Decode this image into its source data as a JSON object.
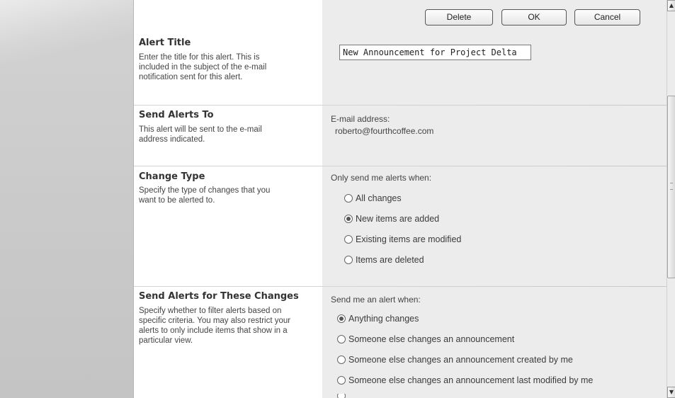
{
  "buttons": {
    "delete": "Delete",
    "ok": "OK",
    "cancel": "Cancel"
  },
  "sections": {
    "alert_title": {
      "title": "Alert Title",
      "description": "Enter the title for this alert. This is included in the subject of the e-mail notification sent for this alert.",
      "input_value": "New Announcement for Project Delta"
    },
    "send_to": {
      "title": "Send Alerts To",
      "description": "This alert will be sent to the e-mail address indicated.",
      "field_label": "E-mail address:",
      "email": "roberto@fourthcoffee.com"
    },
    "change_type": {
      "title": "Change Type",
      "description": "Specify the type of changes that you want to be alerted to.",
      "prompt": "Only send me alerts when:",
      "options": [
        {
          "label": "All changes",
          "checked": false
        },
        {
          "label": "New items are added",
          "checked": true
        },
        {
          "label": "Existing items are modified",
          "checked": false
        },
        {
          "label": "Items are deleted",
          "checked": false
        }
      ]
    },
    "filter": {
      "title": "Send Alerts for These Changes",
      "description": "Specify whether to filter alerts based on specific criteria. You may also restrict your alerts to only include items that show in a particular view.",
      "prompt": "Send me an alert when:",
      "options": [
        {
          "label": "Anything changes",
          "checked": true
        },
        {
          "label": "Someone else changes an announcement",
          "checked": false
        },
        {
          "label": "Someone else changes an announcement created by me",
          "checked": false
        },
        {
          "label": "Someone else changes an announcement last modified by me",
          "checked": false
        }
      ]
    }
  },
  "scrollbar": {
    "up_icon": "arrow-up-icon",
    "down_icon": "arrow-down-icon"
  }
}
